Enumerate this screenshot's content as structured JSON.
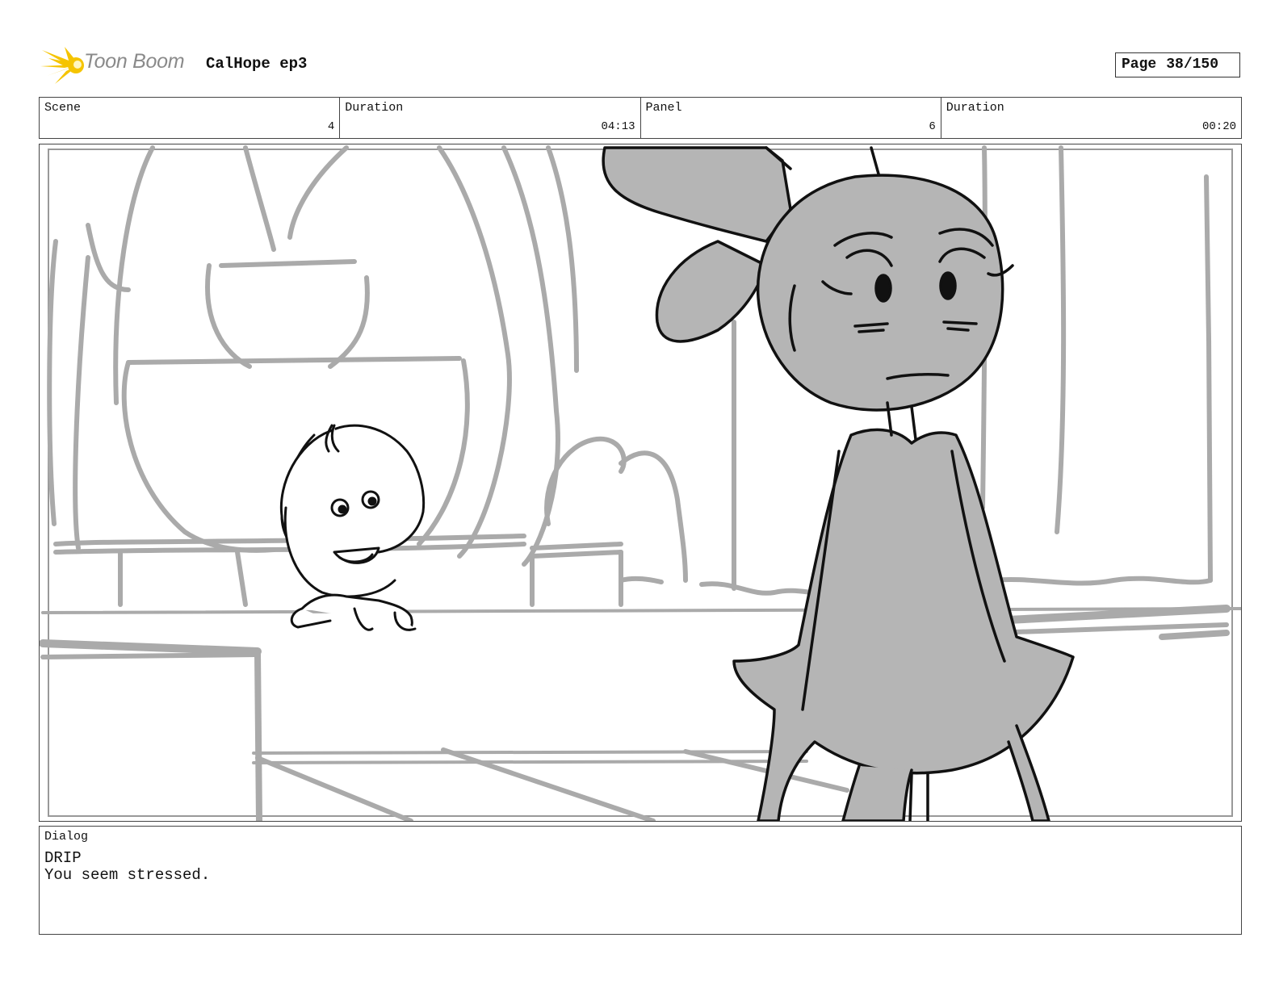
{
  "header": {
    "logo_text": "Toon Boom",
    "logo_icon": "starburst-icon",
    "project_title": "CalHope ep3",
    "page_label": "Page",
    "page_number": "38/150"
  },
  "info_bar": [
    {
      "label": "Scene",
      "value": "4"
    },
    {
      "label": "Duration",
      "value": "04:13"
    },
    {
      "label": "Panel",
      "value": "6"
    },
    {
      "label": "Duration",
      "value": "00:20"
    }
  ],
  "dialog": {
    "label": "Dialog",
    "speaker": "DRIP",
    "line": "You seem stressed."
  },
  "colors": {
    "logo_yellow": "#f5c400",
    "sketch_gray": "#aaaaaa",
    "fill_gray": "#b5b5b5",
    "ink": "#111111"
  }
}
